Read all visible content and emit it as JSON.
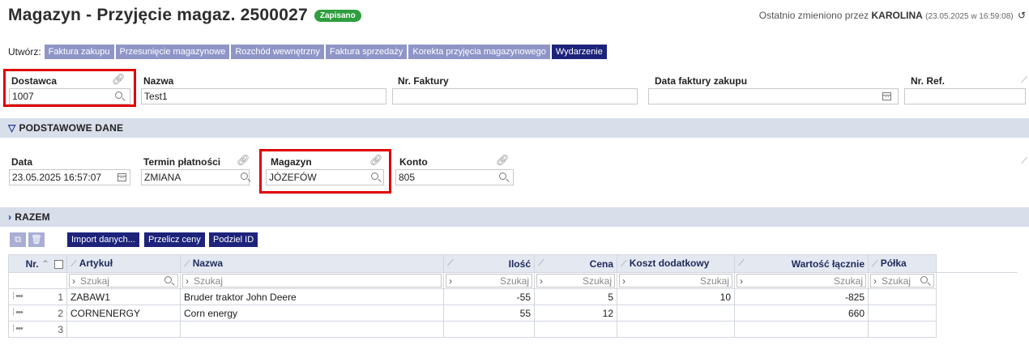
{
  "header": {
    "title": "Magazyn - Przyjęcie magaz. 2500027",
    "badge": "Zapisano",
    "changed_prefix": "Ostatnio zmieniono przez",
    "changed_user": "KAROLINA",
    "changed_time": "(23.05.2025 w 16:59:08)"
  },
  "create": {
    "label": "Utwórz:",
    "buttons": [
      "Faktura zakupu",
      "Przesunięcie magazynowe",
      "Rozchód wewnętrzny",
      "Faktura sprzedaży",
      "Korekta przyjęcia magazynowego",
      "Wydarzenie"
    ]
  },
  "fields": {
    "supplier": {
      "label": "Dostawca",
      "value": "1007"
    },
    "name": {
      "label": "Nazwa",
      "value": "Test1"
    },
    "invoice_no": {
      "label": "Nr. Faktury",
      "value": ""
    },
    "invoice_date": {
      "label": "Data faktury zakupu",
      "value": ""
    },
    "ref_no": {
      "label": "Nr. Ref.",
      "value": ""
    }
  },
  "basic": {
    "section": "PODSTAWOWE DANE",
    "date": {
      "label": "Data",
      "value": "23.05.2025 16:57:07"
    },
    "payment_term": {
      "label": "Termin płatności",
      "value": "ZMIANA"
    },
    "warehouse": {
      "label": "Magazyn",
      "value": "JÓZEFÓW"
    },
    "account": {
      "label": "Konto",
      "value": "805"
    }
  },
  "totals": {
    "section": "RAZEM"
  },
  "toolbar": {
    "import": "Import danych...",
    "recalc": "Przelicz ceny",
    "split": "Podziel ID"
  },
  "table": {
    "headers": {
      "nr": "Nr.",
      "article": "Artykuł",
      "name": "Nazwa",
      "qty": "Ilość",
      "price": "Cena",
      "extra": "Koszt dodatkowy",
      "total": "Wartość łącznie",
      "shelf": "Półka"
    },
    "search_placeholder": "Szukaj",
    "rows": [
      {
        "nr": "1",
        "article": "ZABAW1",
        "name": "Bruder traktor John Deere",
        "qty": "-55",
        "price": "5",
        "extra": "10",
        "total": "-825",
        "shelf": ""
      },
      {
        "nr": "2",
        "article": "CORNENERGY",
        "name": "Corn energy",
        "qty": "55",
        "price": "12",
        "extra": "",
        "total": "660",
        "shelf": ""
      },
      {
        "nr": "3",
        "article": "",
        "name": "",
        "qty": "",
        "price": "",
        "extra": "",
        "total": "",
        "shelf": ""
      }
    ]
  }
}
